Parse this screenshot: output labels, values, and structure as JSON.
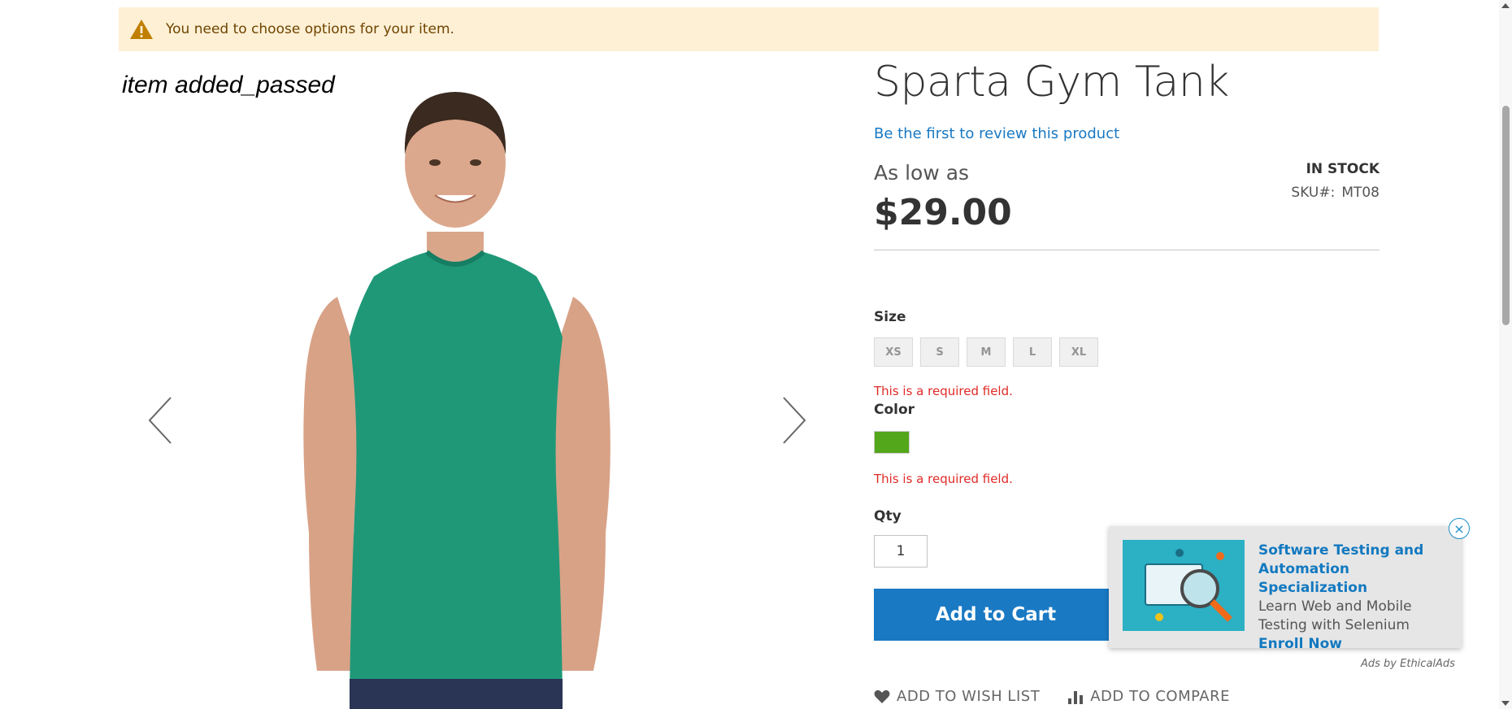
{
  "notice": {
    "icon": "warning-icon",
    "text": "You need to choose options for your item."
  },
  "overlay": {
    "caption": "item added_passed"
  },
  "gallery": {
    "prev_icon": "chevron-left-icon",
    "next_icon": "chevron-right-icon"
  },
  "product": {
    "title": "Sparta Gym Tank",
    "review_link": "Be the first to review this product",
    "price_label": "As low as",
    "price": "$29.00",
    "stock": "IN STOCK",
    "sku_label": "SKU#:",
    "sku_value": "MT08"
  },
  "options": {
    "size_label": "Size",
    "sizes": [
      "XS",
      "S",
      "M",
      "L",
      "XL"
    ],
    "size_error": "This is a required field.",
    "color_label": "Color",
    "color_swatch": "#53a71b",
    "color_error": "This is a required field."
  },
  "qty": {
    "label": "Qty",
    "value": "1"
  },
  "buttons": {
    "add_to_cart": "Add to Cart",
    "wish_list": "ADD TO WISH LIST",
    "compare": "ADD TO COMPARE"
  },
  "ad": {
    "title": "Software Testing and Automation Specialization",
    "body": "Learn Web and Mobile Testing with Selenium",
    "cta": "Enroll Now",
    "close": "×",
    "credit": "Ads by EthicalAds"
  },
  "colors": {
    "accent": "#1979c3",
    "error": "#e02b27",
    "notice_bg": "#fdf0d5"
  }
}
